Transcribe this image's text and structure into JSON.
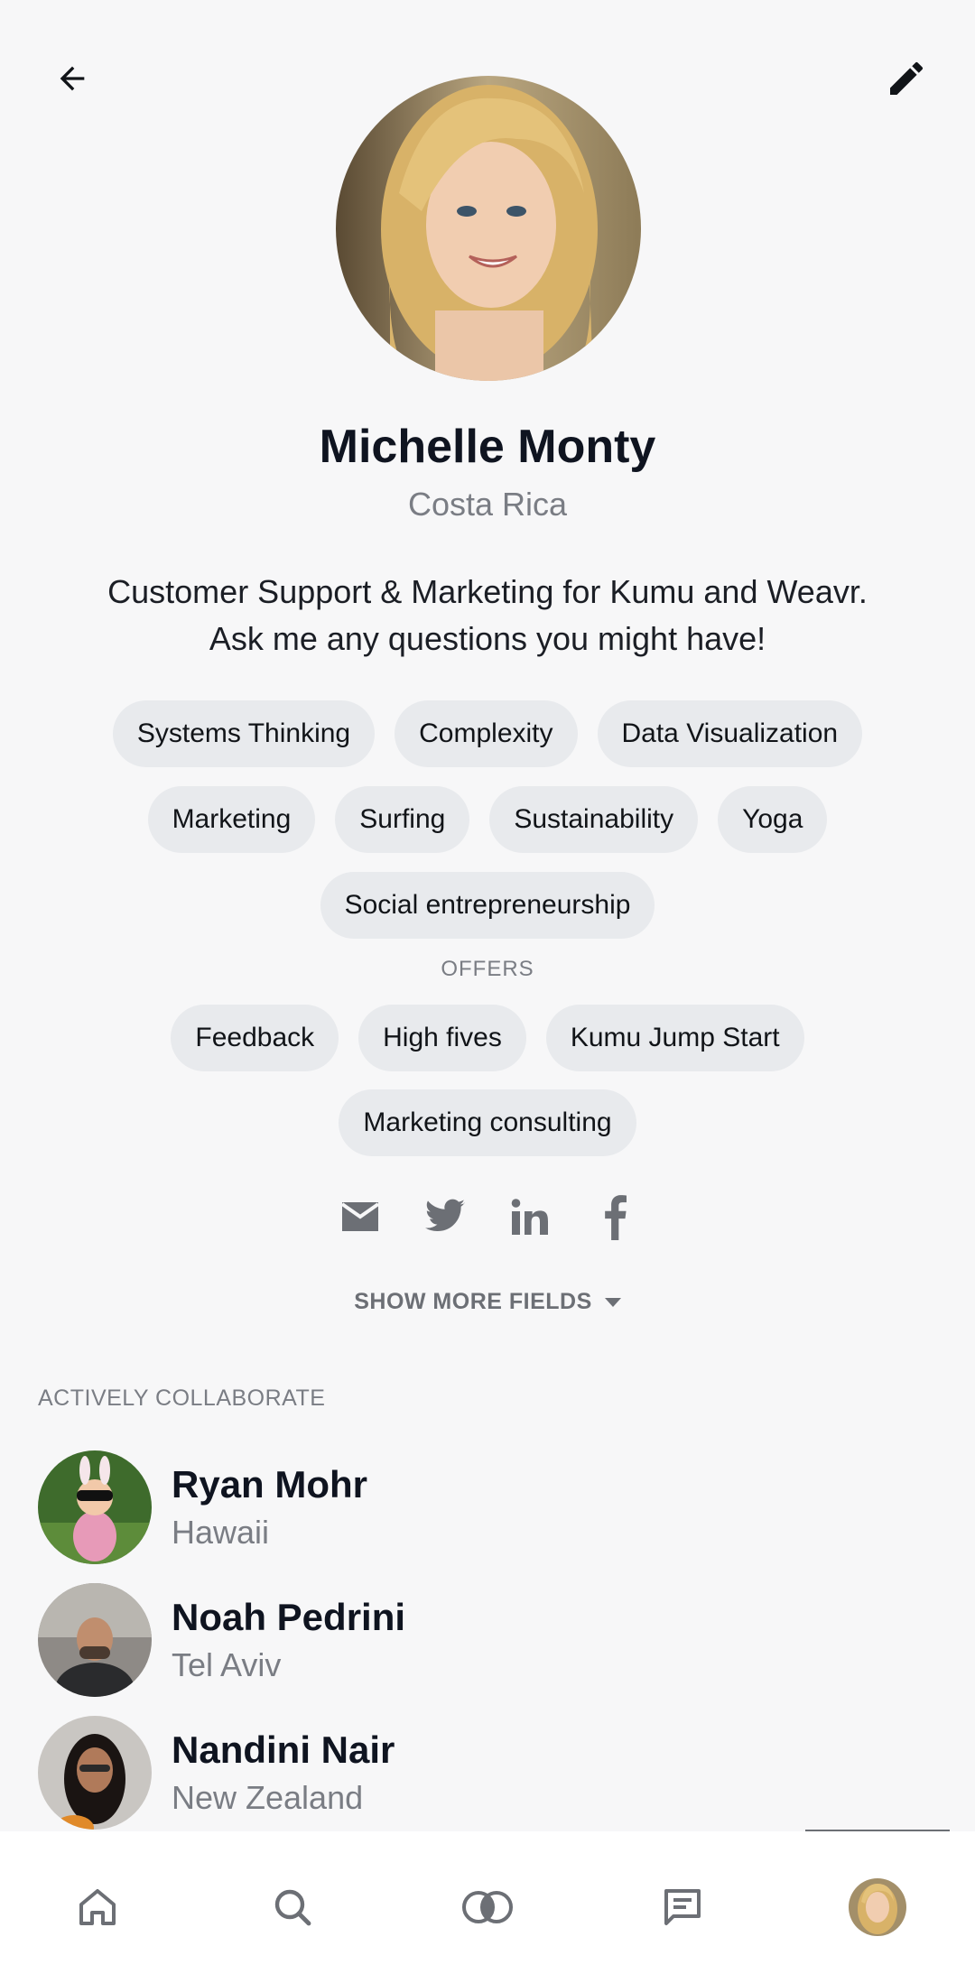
{
  "profile": {
    "name": "Michelle Monty",
    "location": "Costa Rica",
    "bio_line1": "Customer Support & Marketing for Kumu and Weavr.",
    "bio_line2": "Ask me any questions you might have!",
    "tags": [
      "Systems Thinking",
      "Complexity",
      "Data Visualization",
      "Marketing",
      "Surfing",
      "Sustainability",
      "Yoga",
      "Social entrepreneurship"
    ],
    "offers_label": "OFFERS",
    "offers": [
      "Feedback",
      "High fives",
      "Kumu Jump Start",
      "Marketing consulting"
    ],
    "social_icons": [
      "email-icon",
      "twitter-icon",
      "linkedin-icon",
      "facebook-icon"
    ],
    "show_more_label": "SHOW MORE FIELDS"
  },
  "collaborate": {
    "label": "ACTIVELY COLLABORATE",
    "people": [
      {
        "name": "Ryan Mohr",
        "location": "Hawaii"
      },
      {
        "name": "Noah Pedrini",
        "location": "Tel Aviv"
      },
      {
        "name": "Nandini Nair",
        "location": "New Zealand"
      }
    ]
  },
  "nav": {
    "items": [
      "home-icon",
      "search-icon",
      "connections-icon",
      "messages-icon",
      "profile-avatar"
    ],
    "active": "profile-avatar"
  },
  "colors": {
    "background": "#f7f7f8",
    "tag_background": "#e8eaed",
    "text_primary": "#0f1420",
    "text_secondary": "#7a7d84",
    "icon_gray": "#6c6f75"
  }
}
